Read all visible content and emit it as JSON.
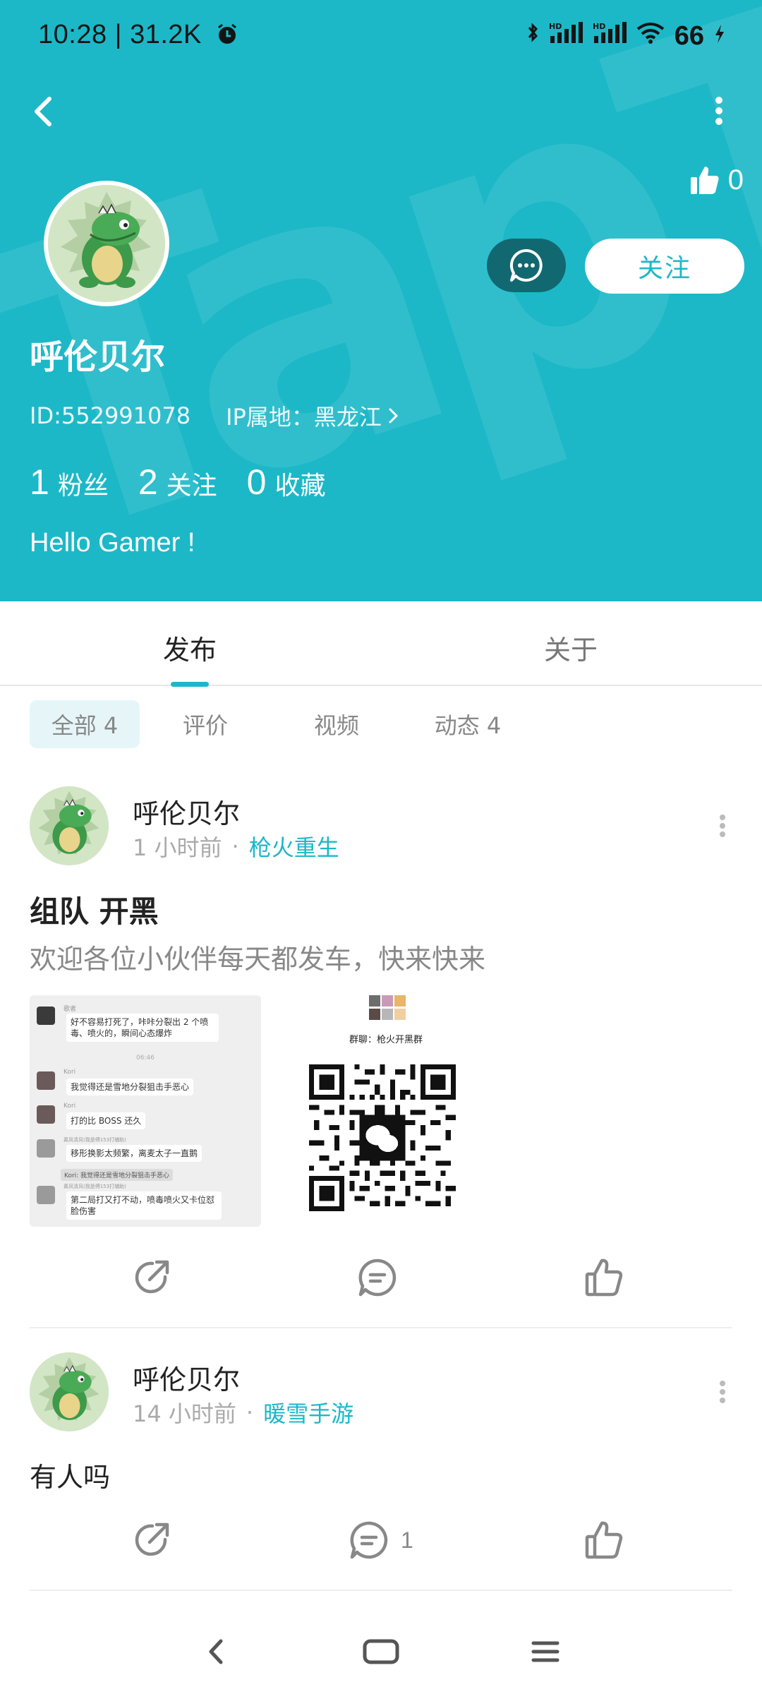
{
  "status_bar": {
    "time": "10:28",
    "net_speed": "31.2K",
    "battery": "66"
  },
  "profile": {
    "like_count": "0",
    "follow_label": "关注",
    "name": "呼伦贝尔",
    "id_text": "ID:552991078",
    "ip_text": "IP属地：黑龙江",
    "stats": [
      {
        "num": "1",
        "label": "粉丝"
      },
      {
        "num": "2",
        "label": "关注"
      },
      {
        "num": "0",
        "label": "收藏"
      }
    ],
    "bio": "Hello Gamer !"
  },
  "main_tabs": [
    {
      "label": "发布",
      "active": true
    },
    {
      "label": "关于",
      "active": false
    }
  ],
  "filter_chips": [
    {
      "label": "全部 4",
      "active": true
    },
    {
      "label": "评价",
      "active": false
    },
    {
      "label": "视频",
      "active": false
    },
    {
      "label": "动态 4",
      "active": false
    }
  ],
  "posts": [
    {
      "author": "呼伦贝尔",
      "time": "1 小时前",
      "game": "枪火重生",
      "title": "组队 开黑",
      "body": "欢迎各位小伙伴每天都发车，快来快来",
      "images": {
        "chat": {
          "time_divider": "06:46",
          "messages": [
            {
              "nick": "歌者",
              "text": "好不容易打死了，咔咔分裂出 2 个喷毒、喷火的，瞬间心态爆炸"
            },
            {
              "nick": "Kori",
              "text": "我觉得还是雪地分裂狙击手恶心"
            },
            {
              "nick": "Kori",
              "text": "打的比 BOSS 还久"
            },
            {
              "nick": "慕凤清风(我是傅153打辅助)",
              "text": "移形换影太频繁，离麦太子一直鹅"
            },
            {
              "nick": "",
              "text": "Kori: 我觉得还是雪地分裂狙击手恶心"
            },
            {
              "nick": "慕凤清风(我是傅153打辅助)",
              "text": "第二局打又打不动，喷毒喷火又卡位怼脸伤害"
            }
          ]
        },
        "qr": {
          "group_label": "群聊：枪火开黑群"
        }
      },
      "comment_count": "",
      "like_count": ""
    },
    {
      "author": "呼伦贝尔",
      "time": "14 小时前",
      "game": "暖雪手游",
      "title": "",
      "body": "有人吗",
      "comment_count": "1",
      "like_count": ""
    }
  ],
  "icons": {
    "back": "chevron-left-icon",
    "more": "more-vertical-icon",
    "like": "thumbs-up-icon",
    "message": "chat-bubble-icon",
    "share": "share-icon",
    "comment": "comment-icon"
  },
  "colors": {
    "accent": "#1cb8c8",
    "message_button": "#126870"
  }
}
